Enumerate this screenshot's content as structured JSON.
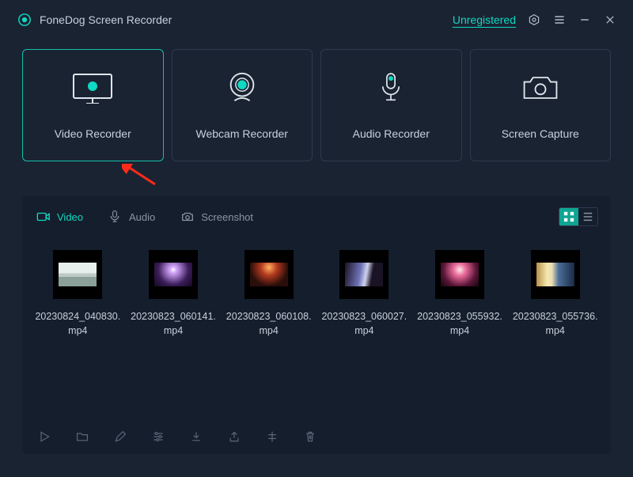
{
  "header": {
    "app_title": "FoneDog Screen Recorder",
    "unregistered_label": "Unregistered"
  },
  "accent_color": "#0fd9c2",
  "modes": {
    "video": "Video Recorder",
    "webcam": "Webcam Recorder",
    "audio": "Audio Recorder",
    "capture": "Screen Capture"
  },
  "library": {
    "tabs": {
      "video": "Video",
      "audio": "Audio",
      "screenshot": "Screenshot"
    },
    "files": [
      {
        "name": "20230824_040830.mp4"
      },
      {
        "name": "20230823_060141.mp4"
      },
      {
        "name": "20230823_060108.mp4"
      },
      {
        "name": "20230823_060027.mp4"
      },
      {
        "name": "20230823_055932.mp4"
      },
      {
        "name": "20230823_055736.mp4"
      }
    ]
  }
}
